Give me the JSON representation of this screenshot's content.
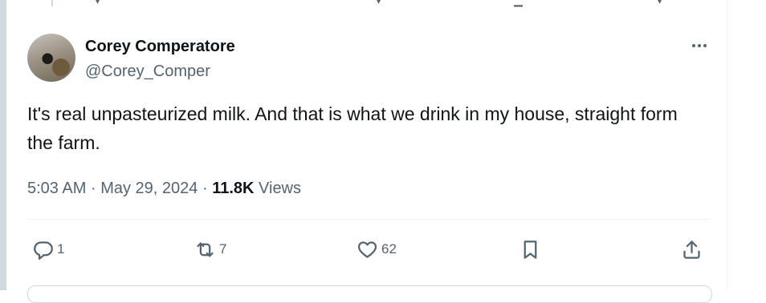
{
  "tweet": {
    "author": {
      "display_name": "Corey Comperatore",
      "handle": "@Corey_Comper"
    },
    "text": "It's real unpasteurized milk. And that is what we drink in my house, straight form the farm.",
    "time": "5:03 AM",
    "separator": "·",
    "date": "May 29, 2024",
    "views_count": "11.8K",
    "views_label": "Views"
  },
  "actions": {
    "reply_count": "1",
    "retweet_count": "7",
    "like_count": "62"
  },
  "icons": {
    "more": "more-horizontal-icon",
    "reply": "reply-icon",
    "retweet": "retweet-icon",
    "like": "heart-icon",
    "bookmark": "bookmark-icon",
    "share": "share-icon"
  },
  "colors": {
    "text_primary": "#0f1419",
    "text_secondary": "#536471",
    "border": "#eff3f4"
  }
}
